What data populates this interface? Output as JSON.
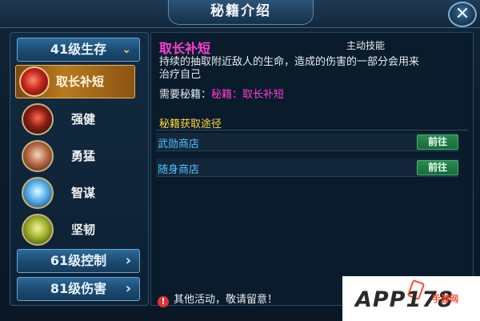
{
  "window": {
    "title": "秘籍介绍",
    "close_label": "✕"
  },
  "categories": {
    "level41": {
      "label": "41级生存",
      "chevron": "⌄"
    },
    "level61": {
      "label": "61级控制",
      "chevron": "›"
    },
    "level81": {
      "label": "81级伤害",
      "chevron": "›"
    }
  },
  "skills": [
    {
      "label": "取长补短",
      "icon": "red-swirl-icon",
      "active": true
    },
    {
      "label": "强健",
      "icon": "armored-warrior-icon",
      "active": false
    },
    {
      "label": "勇猛",
      "icon": "fist-icon",
      "active": false
    },
    {
      "label": "智谋",
      "icon": "blue-orb-icon",
      "active": false
    },
    {
      "label": "坚韧",
      "icon": "green-shield-gem-icon",
      "active": false
    }
  ],
  "detail": {
    "name": "取长补短",
    "type": "主动技能",
    "description": "持续的抽取附近敌人的生命，造成的伤害的一部分会用来治疗自己",
    "requirement_label": "需要秘籍：",
    "requirement_value": "秘籍：取长补短"
  },
  "sources": {
    "title": "秘籍获取途径",
    "rows": [
      {
        "name": "武勋商店",
        "button": "前往"
      },
      {
        "name": "随身商店",
        "button": "前往"
      }
    ]
  },
  "notice": "其他活动，敬请留意！",
  "watermark": {
    "text": "APP178",
    "sub": "手游网"
  },
  "colors": {
    "skill_name": "#ff3fd4",
    "source_title": "#ffd93a",
    "source_name": "#4fc3ff",
    "go_button": "#2a8a50"
  }
}
